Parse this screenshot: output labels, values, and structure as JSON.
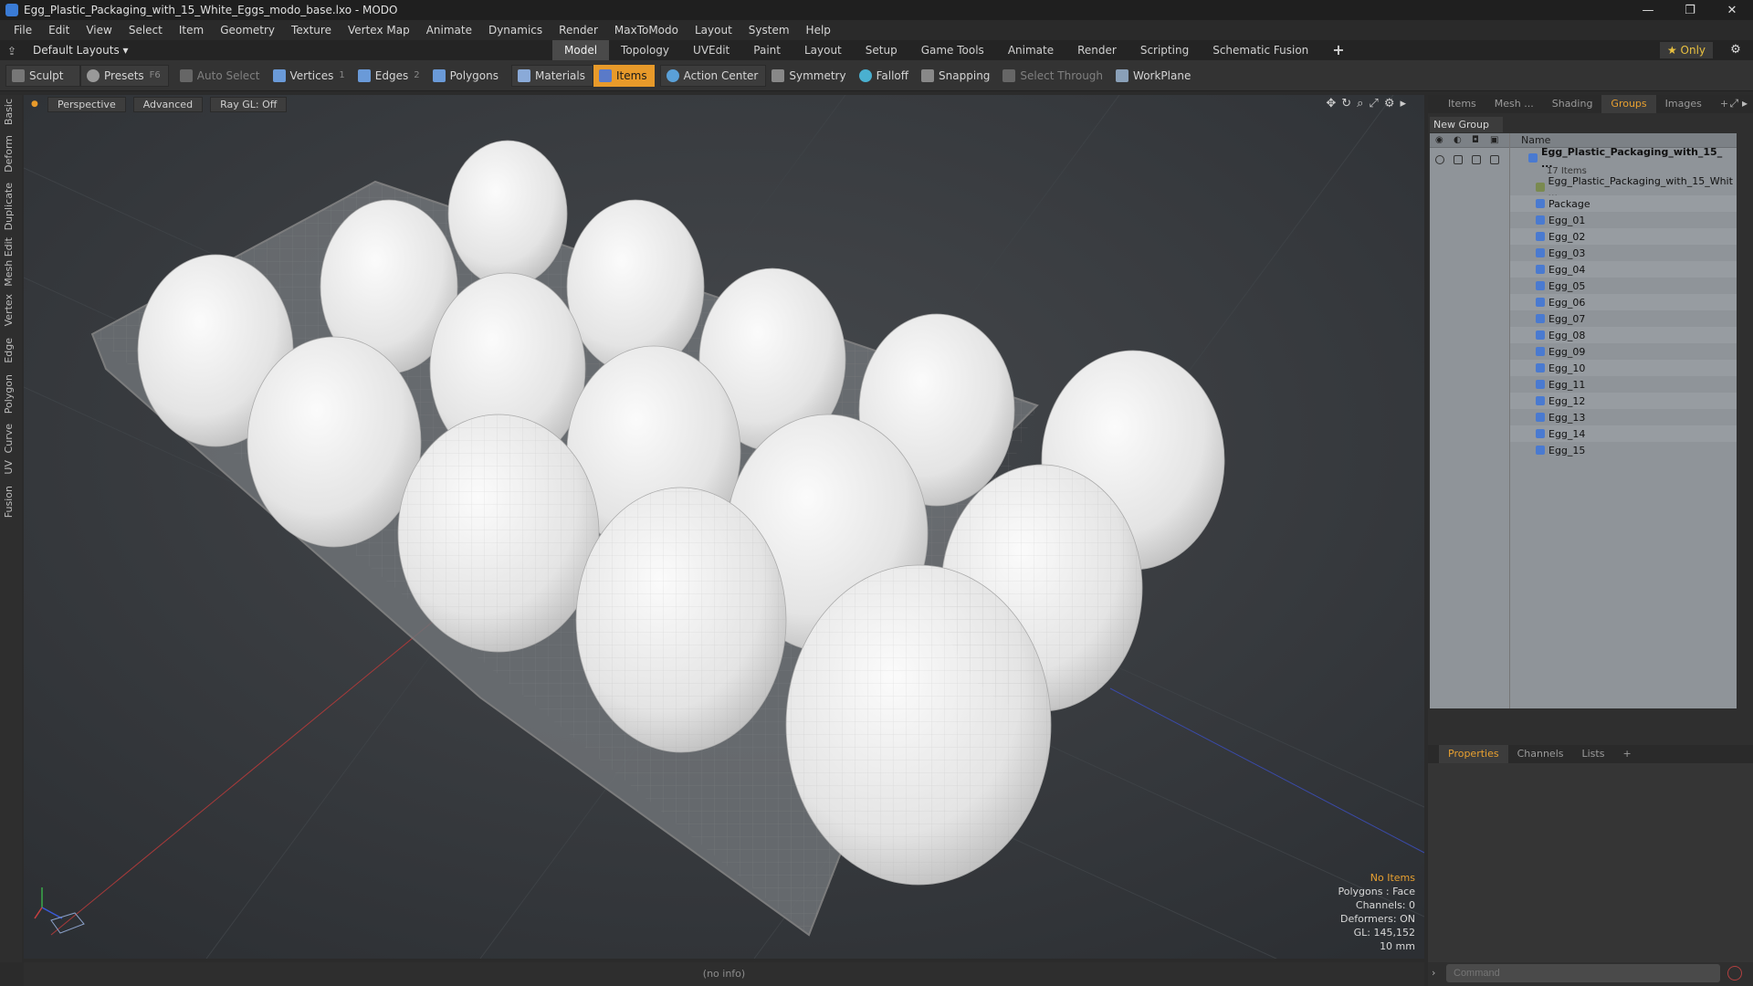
{
  "window": {
    "title": "Egg_Plastic_Packaging_with_15_White_Eggs_modo_base.lxo - MODO",
    "minimize": "—",
    "maximize": "❐",
    "close": "✕"
  },
  "menu": [
    "File",
    "Edit",
    "View",
    "Select",
    "Item",
    "Geometry",
    "Texture",
    "Vertex Map",
    "Animate",
    "Dynamics",
    "Render",
    "MaxToModo",
    "Layout",
    "System",
    "Help"
  ],
  "layouts": {
    "label": "Default Layouts ▾"
  },
  "mode_tabs": [
    "Model",
    "Topology",
    "UVEdit",
    "Paint",
    "Layout",
    "Setup",
    "Game Tools",
    "Animate",
    "Render",
    "Scripting",
    "Schematic Fusion",
    "+"
  ],
  "active_mode": "Model",
  "only_button": "★  Only",
  "toolbar": {
    "sculpt": "Sculpt",
    "presets": "Presets",
    "presets_key": "F6",
    "auto_select": "Auto Select",
    "vertices": "Vertices",
    "vertices_num": "1",
    "edges": "Edges",
    "edges_num": "2",
    "polygons": "Polygons",
    "materials": "Materials",
    "items": "Items",
    "action_center": "Action Center",
    "symmetry": "Symmetry",
    "falloff": "Falloff",
    "snapping": "Snapping",
    "select_through": "Select Through",
    "workplane": "WorkPlane"
  },
  "left_tabs": [
    "Basic",
    "Deform",
    "Duplicate",
    "Mesh Edit",
    "Vertex",
    "Edge",
    "Polygon",
    "Curve",
    "UV",
    "Fusion"
  ],
  "viewport": {
    "perspective": "Perspective",
    "advanced": "Advanced",
    "raygl": "Ray GL: Off",
    "info": {
      "no_items": "No Items",
      "polygons": "Polygons : Face",
      "channels": "Channels: 0",
      "deformers": "Deformers: ON",
      "gl": "GL: 145,152",
      "scale": "10 mm"
    }
  },
  "status": "(no info)",
  "right_panel": {
    "tabs": [
      "Items",
      "Mesh ...",
      "Shading",
      "Groups",
      "Images",
      "+"
    ],
    "active_tab": "Groups",
    "new_group": "New Group",
    "name_header": "Name",
    "root": "Egg_Plastic_Packaging_with_15_ ...",
    "root_count": "17 Items",
    "items": [
      "Egg_Plastic_Packaging_with_15_Whit ...",
      "Package",
      "Egg_01",
      "Egg_02",
      "Egg_03",
      "Egg_04",
      "Egg_05",
      "Egg_06",
      "Egg_07",
      "Egg_08",
      "Egg_09",
      "Egg_10",
      "Egg_11",
      "Egg_12",
      "Egg_13",
      "Egg_14",
      "Egg_15"
    ],
    "props_tabs": [
      "Properties",
      "Channels",
      "Lists",
      "+"
    ],
    "active_props_tab": "Properties",
    "command_placeholder": "Command"
  }
}
